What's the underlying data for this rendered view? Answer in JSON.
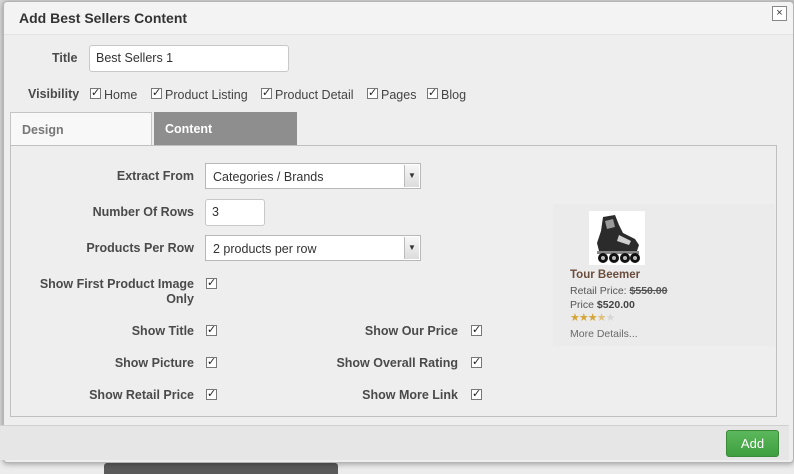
{
  "dialog": {
    "title": "Add Best Sellers Content",
    "close_icon": "×"
  },
  "form": {
    "title_label": "Title",
    "title_value": "Best Sellers 1",
    "visibility_label": "Visibility",
    "visibility_options": [
      {
        "label": "Home",
        "checked": true
      },
      {
        "label": "Product Listing",
        "checked": true
      },
      {
        "label": "Product Detail",
        "checked": true
      },
      {
        "label": "Pages",
        "checked": true
      },
      {
        "label": "Blog",
        "checked": true
      }
    ]
  },
  "tabs": [
    {
      "label": "Design",
      "active": false
    },
    {
      "label": "Content",
      "active": true
    }
  ],
  "content": {
    "extract_from_label": "Extract From",
    "extract_from_value": "Categories / Brands",
    "rows_label": "Number Of Rows",
    "rows_value": "3",
    "per_row_label": "Products Per Row",
    "per_row_value": "2 products per row",
    "first_image_label_1": "Show First Product Image",
    "first_image_label_2": "Only",
    "show_title_label": "Show Title",
    "show_picture_label": "Show Picture",
    "show_retail_price_label": "Show Retail Price",
    "show_our_price_label": "Show Our Price",
    "show_overall_rating_label": "Show Overall Rating",
    "show_more_link_label": "Show More Link",
    "check_mark": "✓",
    "arrow_icon": "▼"
  },
  "preview": {
    "product_name": "Tour Beemer",
    "retail_label": "Retail Price:",
    "retail_value": "$550.00",
    "price_label": "Price",
    "price_value": "$520.00",
    "rating_stars": 3.5,
    "rating_max": 5,
    "more_details": "More Details..."
  },
  "footer": {
    "add_label": "Add"
  },
  "colors": {
    "add_button": "#4cae4c",
    "active_tab": "#8e8e8e",
    "star": "#d4a537"
  }
}
